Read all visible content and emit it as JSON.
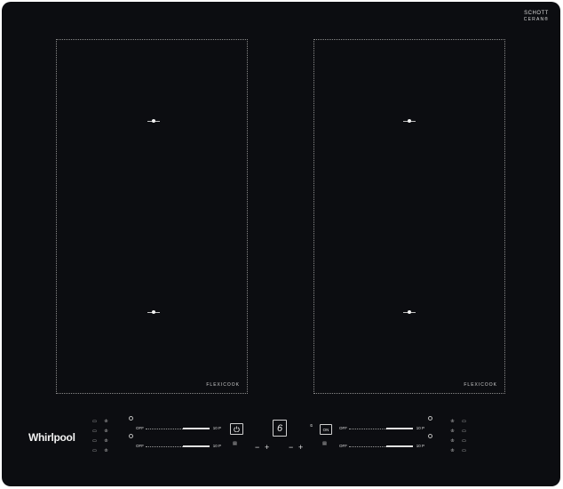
{
  "brand": {
    "schott_line1": "SCHOTT",
    "schott_line2": "CERAN®",
    "whirlpool": "Whirlpool"
  },
  "zones": {
    "left_label": "FLEXICOOK",
    "right_label": "FLEXICOOK"
  },
  "controls": {
    "slider_off": "OFF",
    "slider_max": "10 P",
    "sixth_sense_value": "6",
    "on_label": "ON",
    "power_icon": "power-icon",
    "minus": "−",
    "plus": "+"
  },
  "colors": {
    "glass": "#0c0d11",
    "print": "#d0d0d0"
  }
}
